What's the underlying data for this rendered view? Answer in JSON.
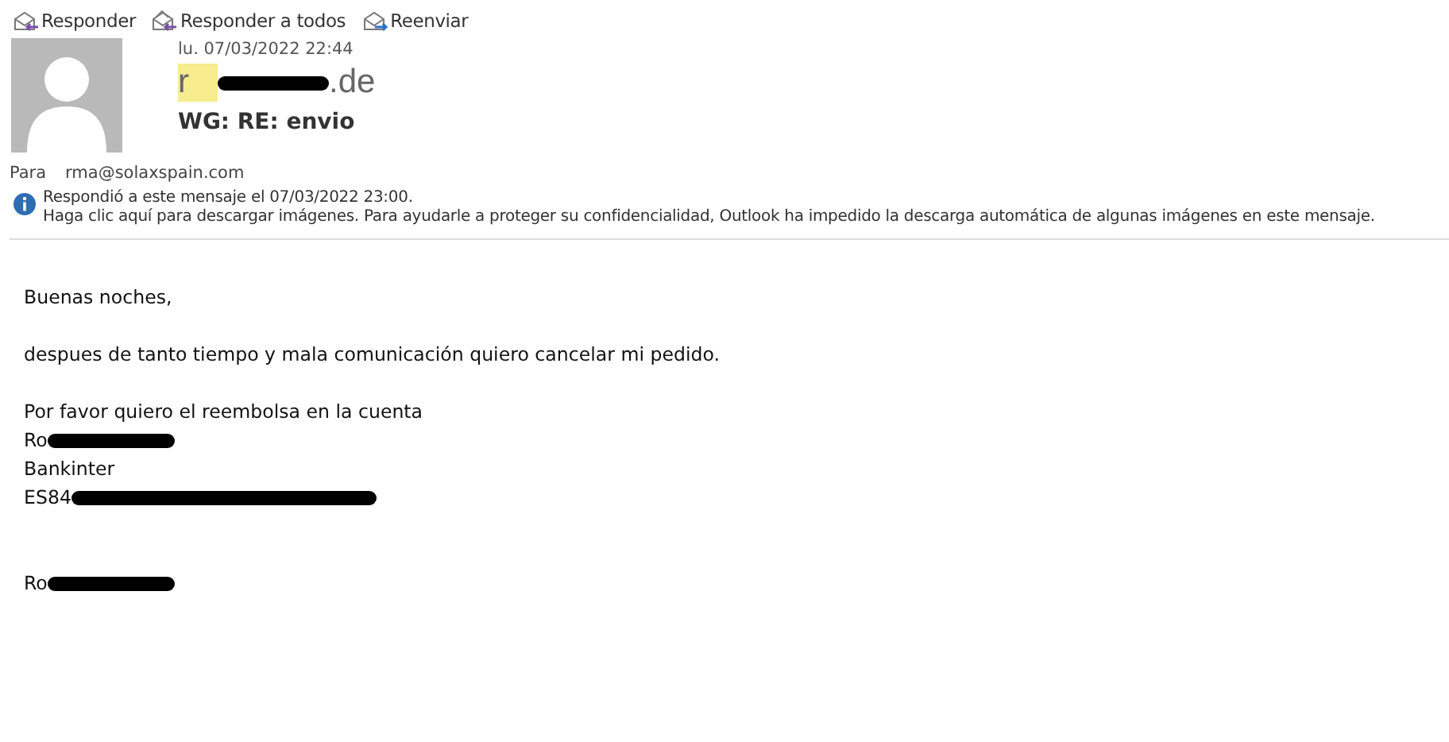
{
  "toolbar": [
    {
      "label": "Responder",
      "kind": "reply"
    },
    {
      "label": "Responder a todos",
      "kind": "reply_all"
    },
    {
      "label": "Reenviar",
      "kind": "forward"
    }
  ],
  "message": {
    "date": "lu. 07/03/2022 22:44",
    "sender": {
      "start": "r",
      "end": ".de",
      "redacted": true
    },
    "subject": "WG:  RE: envio",
    "to_label": "Para",
    "to": "rma@solaxspain.com"
  },
  "info": [
    "Respondió a este mensaje el 07/03/2022 23:00.",
    "Haga clic aquí para descargar imágenes. Para ayudarle a proteger su confidencialidad, Outlook ha impedido la descarga automática de algunas imágenes en este mensaje."
  ],
  "body": [
    [
      {
        "text": "Buenas noches,",
        "redacted": false
      }
    ],
    [
      {
        "text": "despues de tanto tiempo y mala comunicación quiero cancelar mi pedido.",
        "redacted": false
      }
    ],
    [
      {
        "text": "Por favor quiero el reembolsa en la cuenta",
        "redacted": false
      },
      {
        "text": "Ro",
        "redacted": true
      },
      {
        "text": "Bankinter",
        "redacted": false
      },
      {
        "text": "ES84",
        "redacted": true
      }
    ],
    [
      {
        "text": "Ro",
        "redacted": true
      }
    ]
  ]
}
